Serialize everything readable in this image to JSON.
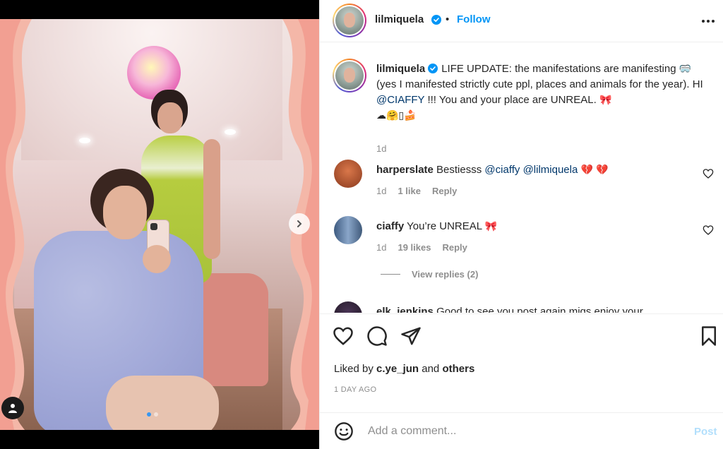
{
  "post": {
    "author": "lilmiquela",
    "separator": "•",
    "follow_label": "Follow",
    "caption_prefix": "LIFE UPDATE: the manifestations are manifesting",
    "caption_part2": "(yes I manifested strictly cute ppl, places and animals for the year). HI",
    "caption_mention": "@CIAFFY",
    "caption_part3": "!!! You and your place are UNREAL.",
    "caption_emoji_1": "🥽",
    "caption_emoji_2": "🎀",
    "caption_emoji_line": "☁🤗▯🍰",
    "caption_time": "1d"
  },
  "comments": [
    {
      "username": "harperslate",
      "text": "Bestiesss",
      "mentions": [
        "@ciaffy",
        "@lilmiquela"
      ],
      "emoji": "💔 💔",
      "time": "1d",
      "likes": "1 like",
      "reply_label": "Reply",
      "avatar_color": "#b0552f"
    },
    {
      "username": "ciaffy",
      "text": "You’re UNREAL",
      "emoji": "🎀",
      "time": "1d",
      "likes": "19 likes",
      "reply_label": "Reply",
      "avatar_color": "#6e87a8"
    },
    {
      "username": "elk_jenkins",
      "text": "Good to see you post again miqs enjoy your",
      "avatar_color": "#2b2031"
    }
  ],
  "view_replies": "View replies (2)",
  "liked_by": {
    "prefix": "Liked by",
    "user": "c.ye_jun",
    "and": "and",
    "others": "others"
  },
  "date": "1 DAY AGO",
  "add_comment": {
    "placeholder": "Add a comment...",
    "post_label": "Post"
  },
  "colors": {
    "accent": "#0095f6",
    "mention": "#00376b",
    "muted": "#8e8e8e",
    "post_disabled": "#b2dffc"
  },
  "icons": [
    "chevron-right-icon",
    "user-tag-icon",
    "verified-icon",
    "more-icon",
    "heart-icon",
    "comment-icon",
    "share-icon",
    "bookmark-icon",
    "emoji-icon"
  ]
}
